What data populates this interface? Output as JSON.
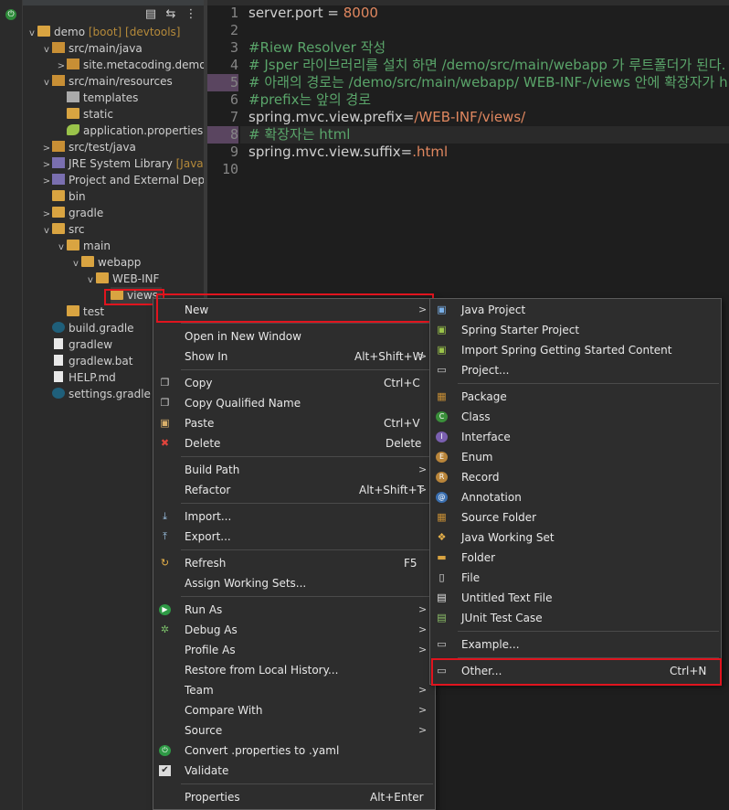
{
  "explorer": {
    "toolbar": [
      "collapse-all-icon",
      "link-editor-icon",
      "view-menu-icon"
    ],
    "rows": [
      {
        "label": "demo",
        "decor": "[boot] [devtools]"
      },
      {
        "label": "src/main/java"
      },
      {
        "label": "site.metacoding.demo"
      },
      {
        "label": "src/main/resources"
      },
      {
        "label": "templates"
      },
      {
        "label": "static"
      },
      {
        "label": "application.properties"
      },
      {
        "label": "src/test/java"
      },
      {
        "label": "JRE System Library",
        "decor": "[JavaSE"
      },
      {
        "label": "Project and External Depen"
      },
      {
        "label": "bin"
      },
      {
        "label": "gradle"
      },
      {
        "label": "src"
      },
      {
        "label": "main"
      },
      {
        "label": "webapp"
      },
      {
        "label": "WEB-INF"
      },
      {
        "label": "views"
      },
      {
        "label": "test"
      },
      {
        "label": "build.gradle"
      },
      {
        "label": "gradlew"
      },
      {
        "label": "gradlew.bat"
      },
      {
        "label": "HELP.md"
      },
      {
        "label": "settings.gradle"
      }
    ]
  },
  "editor": {
    "lines": [
      {
        "num": "1",
        "key": "server.port = ",
        "val": "8000",
        "comment": ""
      },
      {
        "num": "2",
        "key": "",
        "val": "",
        "comment": ""
      },
      {
        "num": "3",
        "key": "",
        "val": "",
        "comment": "#Riew Resolver 작성"
      },
      {
        "num": "4",
        "key": "",
        "val": "",
        "comment": "# Jsper 라이브러리를 설치 하면 /demo/src/main/webapp 가 루트폴더가 된다."
      },
      {
        "num": "5",
        "key": "",
        "val": "",
        "comment": "# 아래의 경로는 /demo/src/main/webapp/ WEB-INF-/views 안에 확장자가 h"
      },
      {
        "num": "6",
        "key": "",
        "val": "",
        "comment": "#prefix는 앞의 경로"
      },
      {
        "num": "7",
        "key": "spring.mvc.view.prefix=",
        "val": "/WEB-INF/views/",
        "comment": ""
      },
      {
        "num": "8",
        "key": "",
        "val": "",
        "comment": "# 확장자는 html"
      },
      {
        "num": "9",
        "key": "spring.mvc.view.suffix=",
        "val": ".html",
        "comment": ""
      },
      {
        "num": "10",
        "key": "",
        "val": "",
        "comment": ""
      }
    ]
  },
  "context_menu": {
    "items": [
      {
        "label": "New",
        "shortcut": "",
        "submenu": true,
        "icon": ""
      },
      {
        "label": "Open in New Window",
        "shortcut": "",
        "submenu": false,
        "icon": ""
      },
      {
        "label": "Show In",
        "shortcut": "Alt+Shift+W",
        "submenu": true,
        "icon": ""
      },
      {
        "label": "Copy",
        "shortcut": "Ctrl+C",
        "submenu": false,
        "icon": "copy-icon"
      },
      {
        "label": "Copy Qualified Name",
        "shortcut": "",
        "submenu": false,
        "icon": "copy-qualified-icon"
      },
      {
        "label": "Paste",
        "shortcut": "Ctrl+V",
        "submenu": false,
        "icon": "paste-icon"
      },
      {
        "label": "Delete",
        "shortcut": "Delete",
        "submenu": false,
        "icon": "delete-icon"
      },
      {
        "label": "Build Path",
        "shortcut": "",
        "submenu": true,
        "icon": ""
      },
      {
        "label": "Refactor",
        "shortcut": "Alt+Shift+T",
        "submenu": true,
        "icon": ""
      },
      {
        "label": "Import...",
        "shortcut": "",
        "submenu": false,
        "icon": "import-icon"
      },
      {
        "label": "Export...",
        "shortcut": "",
        "submenu": false,
        "icon": "export-icon"
      },
      {
        "label": "Refresh",
        "shortcut": "F5",
        "submenu": false,
        "icon": "refresh-icon"
      },
      {
        "label": "Assign Working Sets...",
        "shortcut": "",
        "submenu": false,
        "icon": ""
      },
      {
        "label": "Run As",
        "shortcut": "",
        "submenu": true,
        "icon": "run-icon"
      },
      {
        "label": "Debug As",
        "shortcut": "",
        "submenu": true,
        "icon": "debug-icon"
      },
      {
        "label": "Profile As",
        "shortcut": "",
        "submenu": true,
        "icon": ""
      },
      {
        "label": "Restore from Local History...",
        "shortcut": "",
        "submenu": false,
        "icon": ""
      },
      {
        "label": "Team",
        "shortcut": "",
        "submenu": true,
        "icon": ""
      },
      {
        "label": "Compare With",
        "shortcut": "",
        "submenu": true,
        "icon": ""
      },
      {
        "label": "Source",
        "shortcut": "",
        "submenu": true,
        "icon": ""
      },
      {
        "label": "Convert .properties to .yaml",
        "shortcut": "",
        "submenu": false,
        "icon": "spring-icon"
      },
      {
        "label": "Validate",
        "shortcut": "",
        "submenu": false,
        "icon": "check-icon"
      },
      {
        "label": "Properties",
        "shortcut": "Alt+Enter",
        "submenu": false,
        "icon": ""
      }
    ]
  },
  "new_submenu": {
    "items": [
      {
        "label": "Java Project",
        "shortcut": "",
        "icon": "java-project-icon"
      },
      {
        "label": "Spring Starter Project",
        "shortcut": "",
        "icon": "spring-starter-icon"
      },
      {
        "label": "Import Spring Getting Started Content",
        "shortcut": "",
        "icon": "spring-import-icon"
      },
      {
        "label": "Project...",
        "shortcut": "",
        "icon": "project-icon"
      },
      {
        "label": "Package",
        "shortcut": "",
        "icon": "package-icon"
      },
      {
        "label": "Class",
        "shortcut": "",
        "icon": "class-icon"
      },
      {
        "label": "Interface",
        "shortcut": "",
        "icon": "interface-icon"
      },
      {
        "label": "Enum",
        "shortcut": "",
        "icon": "enum-icon"
      },
      {
        "label": "Record",
        "shortcut": "",
        "icon": "record-icon"
      },
      {
        "label": "Annotation",
        "shortcut": "",
        "icon": "annotation-icon"
      },
      {
        "label": "Source Folder",
        "shortcut": "",
        "icon": "source-folder-icon"
      },
      {
        "label": "Java Working Set",
        "shortcut": "",
        "icon": "working-set-icon"
      },
      {
        "label": "Folder",
        "shortcut": "",
        "icon": "folder-icon"
      },
      {
        "label": "File",
        "shortcut": "",
        "icon": "file-icon"
      },
      {
        "label": "Untitled Text File",
        "shortcut": "",
        "icon": "text-file-icon"
      },
      {
        "label": "JUnit Test Case",
        "shortcut": "",
        "icon": "junit-icon"
      },
      {
        "label": "Example...",
        "shortcut": "",
        "icon": "example-icon"
      },
      {
        "label": "Other...",
        "shortcut": "Ctrl+N",
        "icon": "other-icon"
      }
    ]
  },
  "colors": {
    "highlight_border": "#e0141e",
    "comment": "#5aa56a",
    "value": "#e0875f"
  }
}
